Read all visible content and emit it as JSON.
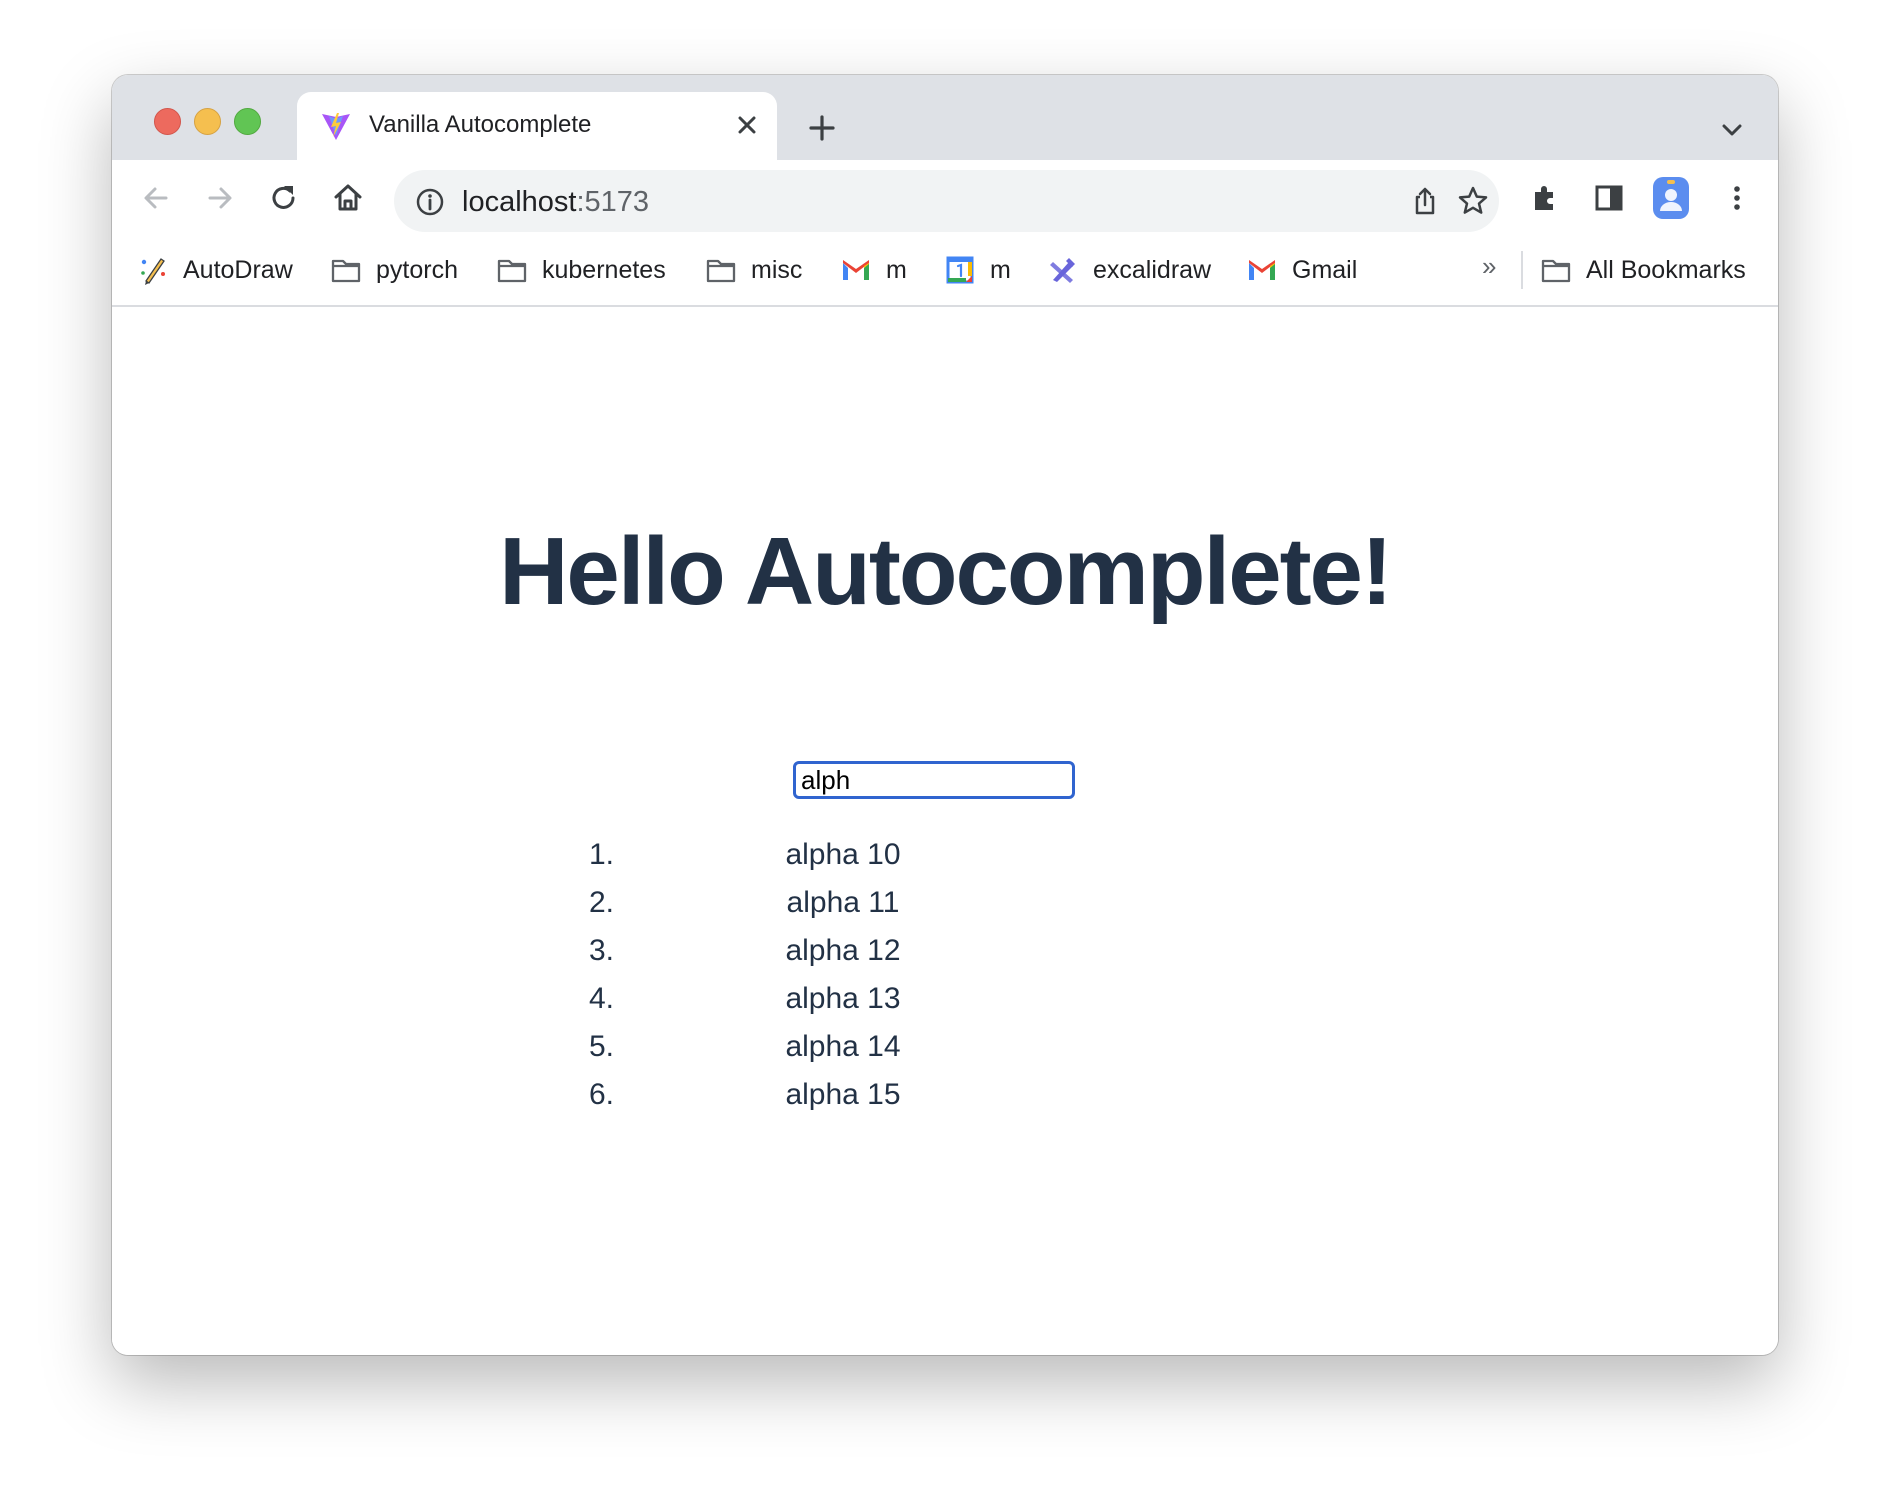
{
  "browser": {
    "tab": {
      "title": "Vanilla Autocomplete"
    },
    "address_bar": {
      "host": "localhost",
      "port": ":5173"
    },
    "bookmarks": [
      {
        "label": "AutoDraw",
        "icon": "autodraw-icon"
      },
      {
        "label": "pytorch",
        "icon": "folder-icon"
      },
      {
        "label": "kubernetes",
        "icon": "folder-icon"
      },
      {
        "label": "misc",
        "icon": "folder-icon"
      },
      {
        "label": "m",
        "icon": "gmail-icon"
      },
      {
        "label": "m",
        "icon": "calendar-icon"
      },
      {
        "label": "excalidraw",
        "icon": "excalidraw-icon"
      },
      {
        "label": "Gmail",
        "icon": "gmail-icon"
      }
    ],
    "more_bookmarks": "»",
    "all_bookmarks": "All Bookmarks"
  },
  "page": {
    "heading": "Hello Autocomplete!",
    "search_value": "alph",
    "results": [
      {
        "number": "1.",
        "text": "alpha 10"
      },
      {
        "number": "2.",
        "text": "alpha 11"
      },
      {
        "number": "3.",
        "text": "alpha 12"
      },
      {
        "number": "4.",
        "text": "alpha 13"
      },
      {
        "number": "5.",
        "text": "alpha 14"
      },
      {
        "number": "6.",
        "text": "alpha 15"
      }
    ]
  },
  "colors": {
    "heading": "#223145",
    "input_focus": "#3064cf",
    "tab_strip": "#dee1e6",
    "omnibox": "#f1f3f4"
  }
}
